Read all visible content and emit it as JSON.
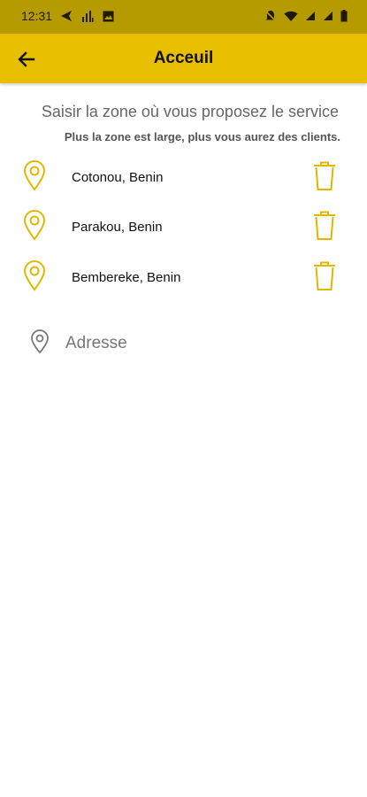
{
  "status_bar": {
    "time": "12:31",
    "left_icons": [
      "send-icon",
      "signal-bars-icon",
      "image-icon"
    ],
    "right_icons": [
      "mute-bell-icon",
      "wifi-icon",
      "cell-signal-icon",
      "cell-signal-icon",
      "battery-icon"
    ]
  },
  "app_bar": {
    "title": "Acceuil",
    "back_icon": "arrow-left-icon"
  },
  "instructions": {
    "main": "Saisir la zone où vous proposez le service",
    "sub": "Plus la zone est large, plus vous aurez des clients."
  },
  "zones": [
    {
      "label": "Cotonou, Benin"
    },
    {
      "label": "Parakou, Benin"
    },
    {
      "label": "Bembereke, Benin"
    }
  ],
  "address": {
    "placeholder": "Adresse",
    "value": ""
  },
  "colors": {
    "accent": "#e8bf00",
    "status_bar": "#b59a00",
    "icon": "#e0b800"
  }
}
